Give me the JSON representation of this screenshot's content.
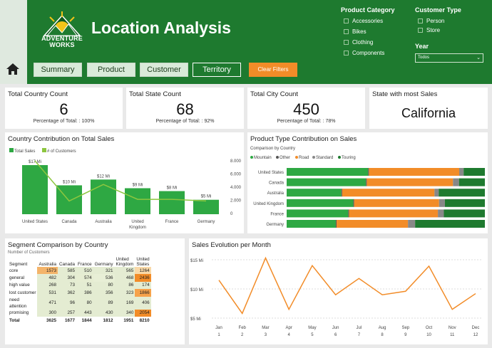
{
  "header": {
    "title": "Location Analysis",
    "logo_text_1": "ADVENTURE",
    "logo_text_2": "WORKS"
  },
  "tabs": [
    {
      "label": "Summary"
    },
    {
      "label": "Product"
    },
    {
      "label": "Customer"
    },
    {
      "label": "Territory"
    }
  ],
  "clear_filters_label": "Clear Filters",
  "filters": {
    "product_category": {
      "heading": "Product Category",
      "options": [
        "Accessories",
        "Bikes",
        "Clothing",
        "Components"
      ]
    },
    "customer_type": {
      "heading": "Customer Type",
      "options": [
        "Person",
        "Store"
      ]
    },
    "year": {
      "heading": "Year",
      "value": "Todos"
    }
  },
  "kpis": [
    {
      "title": "Total Country Count",
      "value": "6",
      "sub": "Percentage of Total: : 100%"
    },
    {
      "title": "Total State Count",
      "value": "68",
      "sub": "Percentage of Total: : 92%"
    },
    {
      "title": "Total City Count",
      "value": "450",
      "sub": "Percentage of Total: : 78%"
    },
    {
      "title": "State with most Sales",
      "value": "California",
      "sub": ""
    }
  ],
  "colors": {
    "green": "#2ea843",
    "orange": "#f28c28",
    "grey": "#666666",
    "dark_green": "#1e7a2f",
    "light_green": "#8dc63f"
  },
  "chart_data": [
    {
      "type": "bar",
      "title": "Country Contribution on Total Sales",
      "legend": [
        "Total Sales",
        "# of Customers"
      ],
      "categories": [
        "United States",
        "Canada",
        "Australia",
        "United Kingdom",
        "France",
        "Germany"
      ],
      "series": [
        {
          "name": "Total Sales",
          "values": [
            17,
            10,
            12,
            9,
            8,
            5
          ],
          "labels": [
            "$17 Mi",
            "$10 Mi",
            "$12 Mi",
            "$9 Mi",
            "$8 Mi",
            "$5 Mi"
          ]
        },
        {
          "name": "# of Customers",
          "values": [
            7800,
            1600,
            3600,
            1800,
            1800,
            1600
          ]
        }
      ],
      "y2_ticks": [
        "8.000",
        "6.000",
        "4.000",
        "2.000",
        "0"
      ],
      "y2lim": [
        0,
        8000
      ]
    },
    {
      "type": "bar",
      "stacked": "100%",
      "orientation": "horizontal",
      "title": "Product Type Contribution on Sales",
      "legend_title": "Comparison by Country",
      "categories": [
        "United States",
        "Canada",
        "Australia",
        "United Kingdom",
        "France",
        "Germany"
      ],
      "series": [
        {
          "name": "Mountain",
          "values": [
            46,
            46,
            32,
            40,
            36,
            31
          ]
        },
        {
          "name": "Other",
          "values": [
            0.5,
            0.5,
            0.5,
            0.5,
            0.5,
            0.5
          ]
        },
        {
          "name": "Road",
          "values": [
            51,
            50,
            54,
            51,
            52,
            45
          ]
        },
        {
          "name": "Standard",
          "values": [
            2.5,
            3.5,
            2.5,
            3.5,
            3.5,
            4.5
          ]
        },
        {
          "name": "Touring",
          "values": [
            12,
            15,
            27,
            24,
            24,
            44
          ]
        }
      ]
    },
    {
      "type": "table",
      "title": "Segment Comparison by Country",
      "subtitle": "Number of Customers",
      "columns": [
        "Segment",
        "Australia",
        "Canada",
        "France",
        "Germany",
        "United Kingdom",
        "United States"
      ],
      "rows": [
        [
          "core",
          "1573",
          "585",
          "510",
          "321",
          "565",
          "1264"
        ],
        [
          "general",
          "482",
          "304",
          "574",
          "536",
          "468",
          "2436"
        ],
        [
          "high value",
          "268",
          "73",
          "51",
          "80",
          "86",
          "174"
        ],
        [
          "lost customer",
          "531",
          "362",
          "386",
          "356",
          "323",
          "1866"
        ],
        [
          "need attention",
          "471",
          "96",
          "80",
          "89",
          "169",
          "406"
        ],
        [
          "promising",
          "300",
          "257",
          "443",
          "430",
          "340",
          "2054"
        ],
        [
          "Total",
          "3625",
          "1677",
          "1844",
          "1812",
          "1951",
          "8210"
        ]
      ]
    },
    {
      "type": "line",
      "title": "Sales Evolution per Month",
      "x": [
        "Jan 1",
        "Feb 2",
        "Mar 3",
        "Apr 4",
        "May 5",
        "Jun 6",
        "Jul 7",
        "Aug 8",
        "Sep 9",
        "Oct 10",
        "Nov 11",
        "Dec 12"
      ],
      "values": [
        11.5,
        5.8,
        15.3,
        6.5,
        14.0,
        9.0,
        11.8,
        9.0,
        9.6,
        13.9,
        6.5,
        9.2
      ],
      "y_ticks": [
        "$15 Mi",
        "$10 Mi",
        "$5 Mi"
      ],
      "ylim": [
        5,
        15
      ]
    }
  ]
}
